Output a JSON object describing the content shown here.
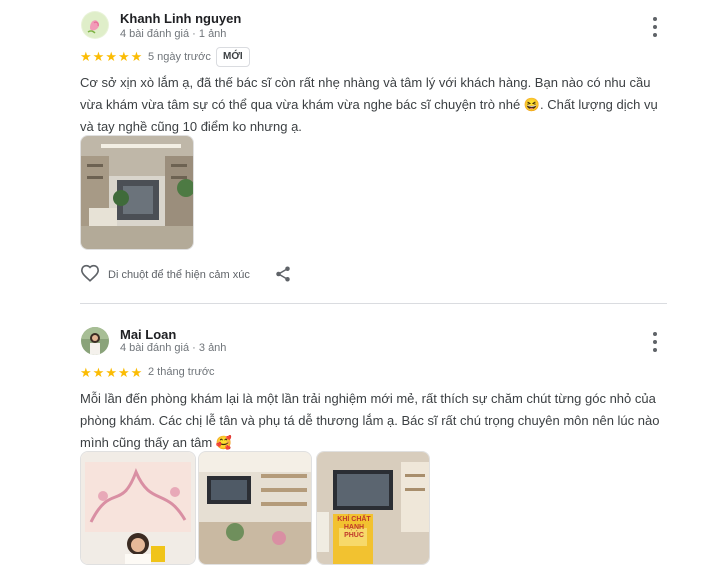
{
  "reviews": [
    {
      "name": "Khanh Linh nguyen",
      "meta": "4 bài đánh giá · 1 ảnh",
      "stars": 5,
      "when": "5 ngày trước",
      "badge": "MỚI",
      "text": "Cơ sở xịn xò lắm ạ, đã thế bác sĩ còn rất nhẹ nhàng và tâm lý với khách hàng. Bạn nào có nhu cầu vừa khám vừa tâm sự có thể qua vừa khám vừa nghe bác sĩ chuyện trò nhé 😆. Chất lượng dịch vụ và tay nghề cũng 10 điểm ko nhưng ạ.",
      "react_label": "Di chuột để thể hiện cảm xúc"
    },
    {
      "name": "Mai Loan",
      "meta": "4 bài đánh giá · 3 ảnh",
      "stars": 5,
      "when": "2 tháng trước",
      "text": "Mỗi lần đến phòng khám lại là một lần trải nghiệm mới mẻ, rất thích sự chăm chút từng góc nhỏ của phòng khám. Các chị lễ tân và phụ tá dễ thương lắm ạ. Bác sĩ rất chú trọng chuyên môn nên lúc nào mình cũng thấy an tâm 🥰",
      "photo_caption": "KHÍ CHẤT HẠNH PHÚC"
    }
  ],
  "icons": {
    "more": "more-vert-icon",
    "heart": "heart-outline-icon",
    "share": "share-icon",
    "star": "star-icon"
  },
  "colors": {
    "star": "#fbbc04",
    "meta": "#70757a",
    "text": "#3c4043"
  }
}
